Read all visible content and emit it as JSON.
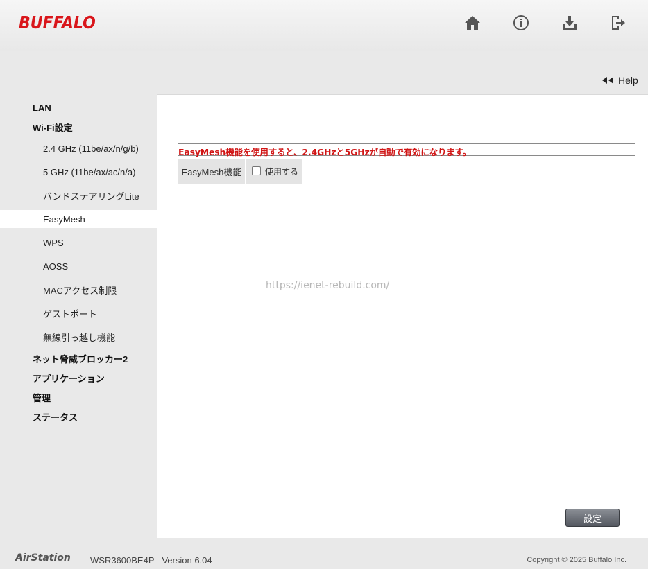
{
  "header": {
    "logo": "BUFFALO",
    "icons": [
      "home-icon",
      "info-icon",
      "download-icon",
      "logout-icon"
    ]
  },
  "help": {
    "label": "Help"
  },
  "sidebar": {
    "items": [
      {
        "label": "LAN",
        "level": "top"
      },
      {
        "label": "Wi-Fi設定",
        "level": "top"
      },
      {
        "label": "2.4 GHz (11be/ax/n/g/b)",
        "level": "sub"
      },
      {
        "label": "5 GHz (11be/ax/ac/n/a)",
        "level": "sub"
      },
      {
        "label": "バンドステアリングLite",
        "level": "sub"
      },
      {
        "label": "EasyMesh",
        "level": "sub",
        "active": true
      },
      {
        "label": "WPS",
        "level": "sub"
      },
      {
        "label": "AOSS",
        "level": "sub"
      },
      {
        "label": "MACアクセス制限",
        "level": "sub"
      },
      {
        "label": "ゲストポート",
        "level": "sub"
      },
      {
        "label": "無線引っ越し機能",
        "level": "sub"
      },
      {
        "label": "ネット脅威ブロッカー2",
        "level": "top"
      },
      {
        "label": "アプリケーション",
        "level": "top"
      },
      {
        "label": "管理",
        "level": "top"
      },
      {
        "label": "ステータス",
        "level": "top"
      }
    ]
  },
  "main": {
    "notice": "EasyMesh機能を使用すると、2.4GHzと5GHzが自動で有効になります。",
    "form": {
      "label": "EasyMesh機能",
      "checkbox_label": "使用する",
      "checked": false
    },
    "watermark": "https://ienet-rebuild.com/",
    "save_label": "設定"
  },
  "footer": {
    "brand": "AirStation",
    "model": "WSR3600BE4P",
    "version": "Version 6.04",
    "copyright": "Copyright © 2025 Buffalo Inc."
  },
  "colors": {
    "brand": "#d9161b",
    "notice": "#d11515",
    "button": "#5a5e66"
  }
}
